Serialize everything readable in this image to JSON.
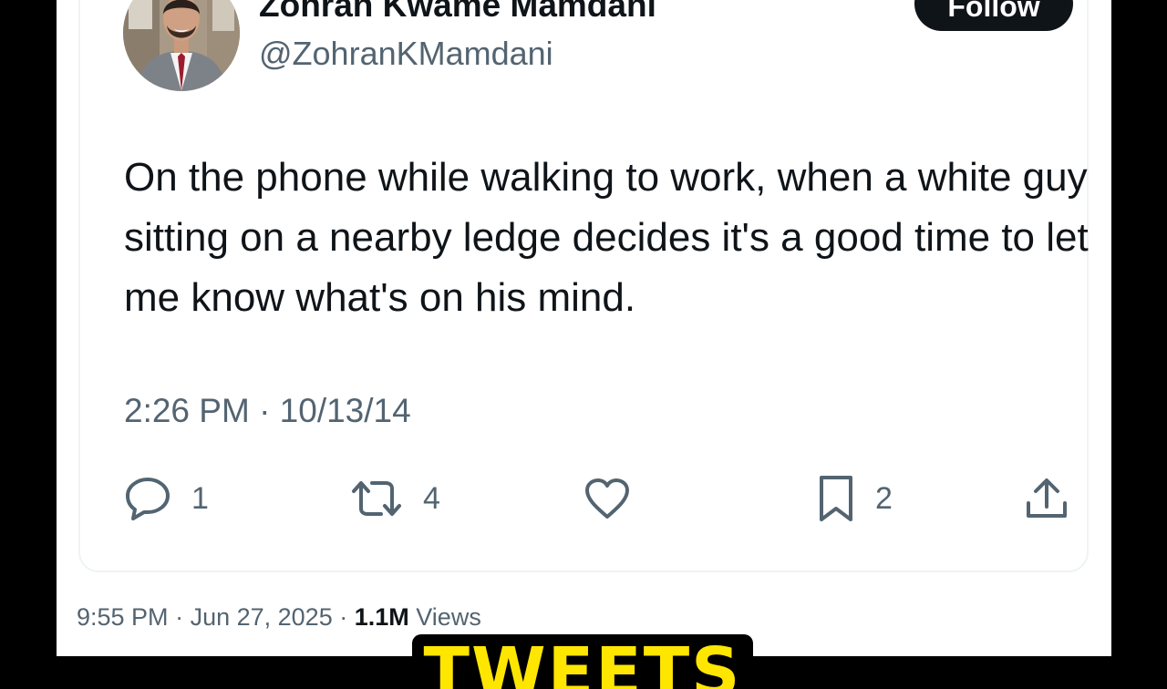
{
  "author": {
    "display_name": "Zohran Kwame Mamdani",
    "handle": "@ZohranKMamdani"
  },
  "follow_label": "Follow",
  "tweet": {
    "text": "On the phone while walking to work, when a white guy sitting on a nearby ledge decides it's a good time to let me know what's on his mind.",
    "timestamp": "2:26 PM · 10/13/14"
  },
  "actions": {
    "reply": {
      "icon": "reply-icon",
      "count": "1"
    },
    "retweet": {
      "icon": "retweet-icon",
      "count": "4"
    },
    "like": {
      "icon": "heart-icon"
    },
    "bookmark": {
      "icon": "bookmark-icon",
      "count": "2"
    },
    "share": {
      "icon": "share-icon"
    }
  },
  "footer": {
    "time": "9:55 PM",
    "date": "Jun 27, 2025",
    "views_count": "1.1M",
    "views_label": "Views"
  },
  "caption": "TWEETS",
  "colors": {
    "text_primary": "#0f1419",
    "text_secondary": "#536471",
    "caption_yellow": "#ffe600",
    "border": "#eff3f4"
  }
}
